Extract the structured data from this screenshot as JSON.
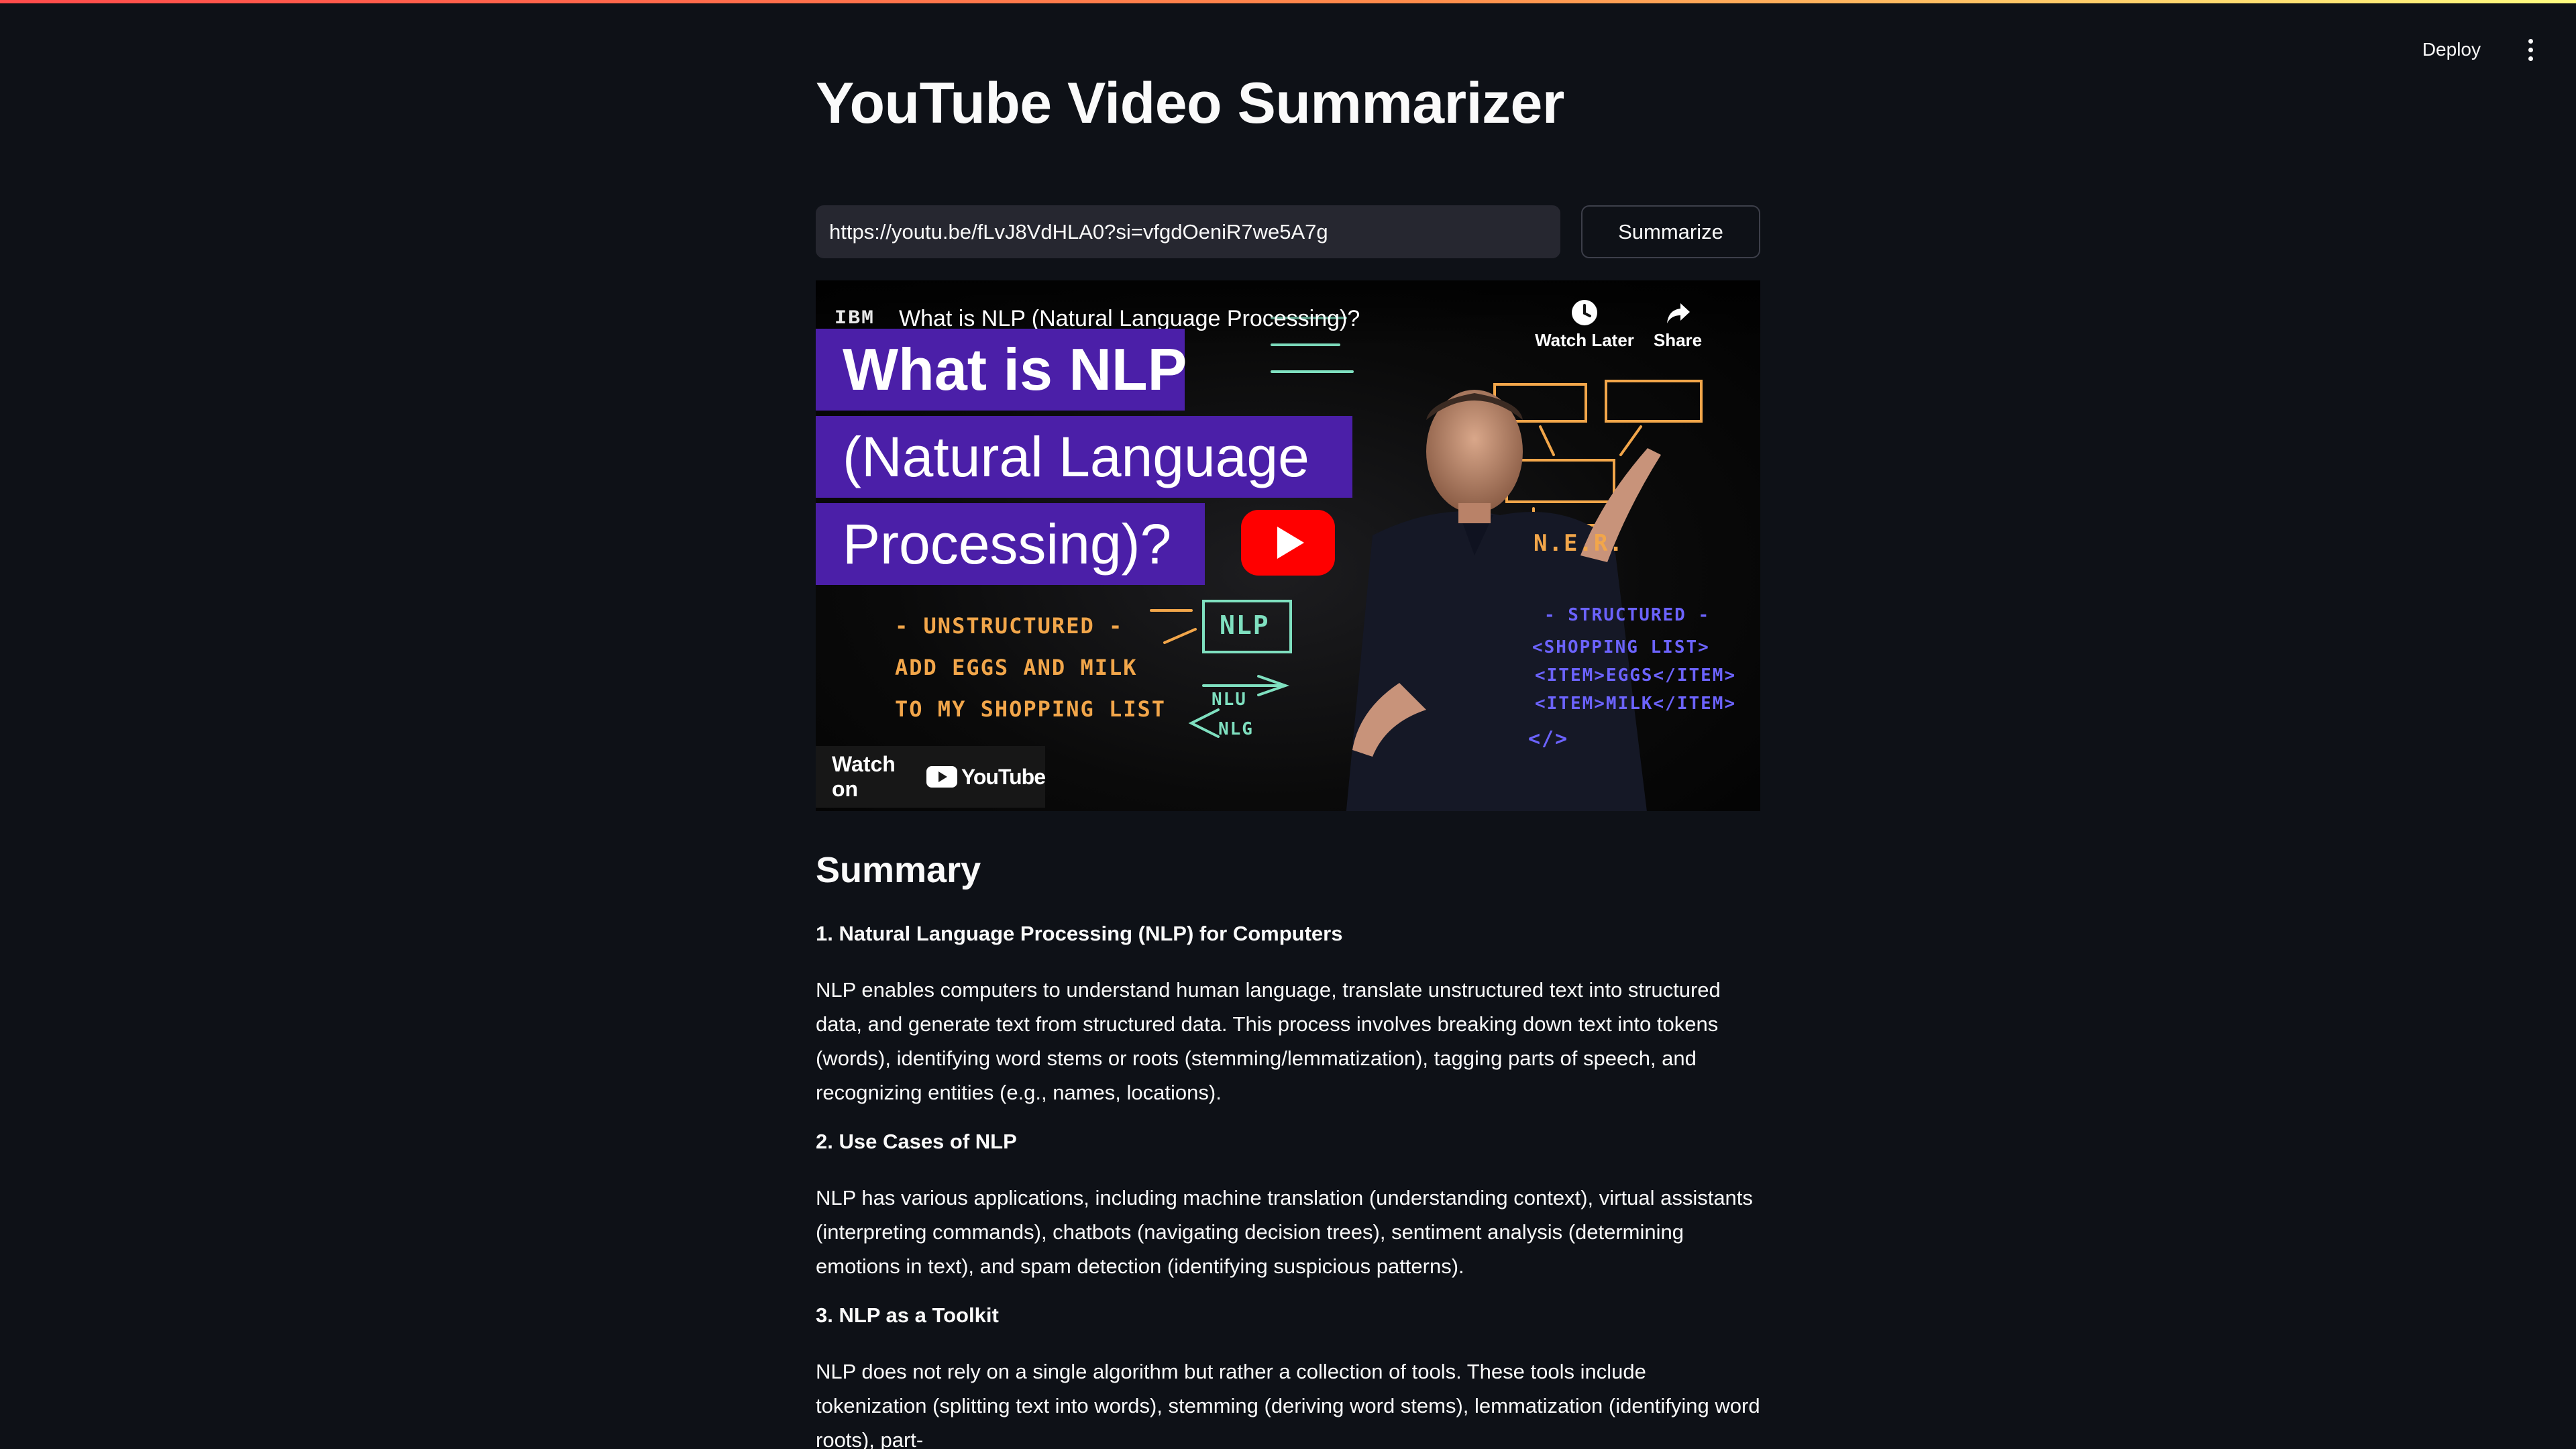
{
  "toolbar": {
    "deploy_label": "Deploy",
    "menu_icon": "kebab-menu-icon"
  },
  "page": {
    "title": "YouTube Video Summarizer"
  },
  "form": {
    "url_value": "https://youtu.be/fLvJ8VdHLA0?si=vfgdOeniR7we5A7g",
    "summarize_label": "Summarize"
  },
  "video": {
    "channel_logo": "IBM",
    "title": "What is NLP (Natural Language Processing)?",
    "watch_later_label": "Watch Later",
    "share_label": "Share",
    "banner": [
      "What is NLP",
      "(Natural Language",
      "Processing)?"
    ],
    "chalk_left": [
      "- UNSTRUCTURED -",
      "ADD EGGS AND MILK",
      "TO MY SHOPPING LIST"
    ],
    "chalk_nlp": "NLP",
    "chalk_nlu": "NLU",
    "chalk_nlg": "NLG",
    "chalk_right": [
      "N.E.R.",
      "- STRUCTURED -",
      "<SHOPPING LIST>",
      "<ITEM>EGGS</ITEM>",
      "<ITEM>MILK</ITEM>",
      "</>"
    ],
    "watch_on_label": "Watch on",
    "youtube_wordmark": "YouTube",
    "colors": {
      "banner": "#4b1fa8",
      "play": "#ff0000"
    }
  },
  "summary": {
    "heading": "Summary",
    "items": [
      {
        "title": "1. Natural Language Processing (NLP) for Computers",
        "body": "NLP enables computers to understand human language, translate unstructured text into structured data, and generate text from structured data. This process involves breaking down text into tokens (words), identifying word stems or roots (stemming/lemmatization), tagging parts of speech, and recognizing entities (e.g., names, locations)."
      },
      {
        "title": "2. Use Cases of NLP",
        "body": "NLP has various applications, including machine translation (understanding context), virtual assistants (interpreting commands), chatbots (navigating decision trees), sentiment analysis (determining emotions in text), and spam detection (identifying suspicious patterns)."
      },
      {
        "title": "3. NLP as a Toolkit",
        "body": "NLP does not rely on a single algorithm but rather a collection of tools. These tools include tokenization (splitting text into words), stemming (deriving word stems), lemmatization (identifying word roots), part-"
      }
    ]
  },
  "theme": {
    "background": "#0e1117",
    "input_background": "#262730",
    "text": "#fafafa",
    "accent_gradient": [
      "#ff4b4b",
      "#fffd80"
    ]
  }
}
